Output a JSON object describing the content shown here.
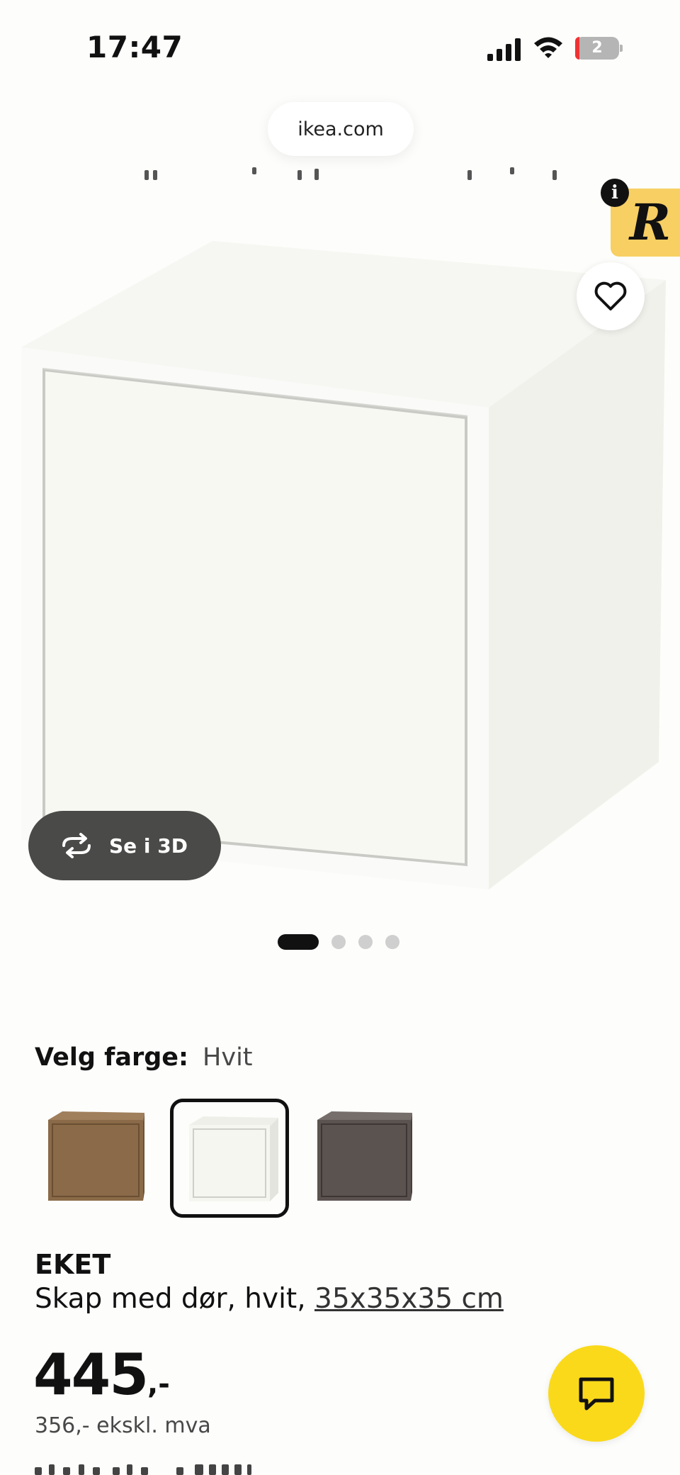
{
  "status_bar": {
    "time": "17:47",
    "battery_level": "2"
  },
  "browser": {
    "url": "ikea.com"
  },
  "gallery": {
    "view_3d_label": "Se i 3D",
    "slide_count": 4,
    "active_slide": 1
  },
  "color_picker": {
    "label": "Velg farge:",
    "selected": "Hvit",
    "swatches": [
      {
        "name": "walnut-effect",
        "color": "#8a6a48"
      },
      {
        "name": "white",
        "color": "#f3f3ee"
      },
      {
        "name": "dark-grey",
        "color": "#5b5350"
      }
    ]
  },
  "product": {
    "name": "EKET",
    "description": "Skap med dør, hvit, ",
    "size_link": "35x35x35 cm",
    "price_main": "445",
    "price_suffix": ",-",
    "price_excl_vat": "356,- ekskl. mva"
  },
  "colors": {
    "ikea_yellow": "#fad91a",
    "badge_yellow": "#f7cf63",
    "dark_button": "#4a4a48"
  }
}
